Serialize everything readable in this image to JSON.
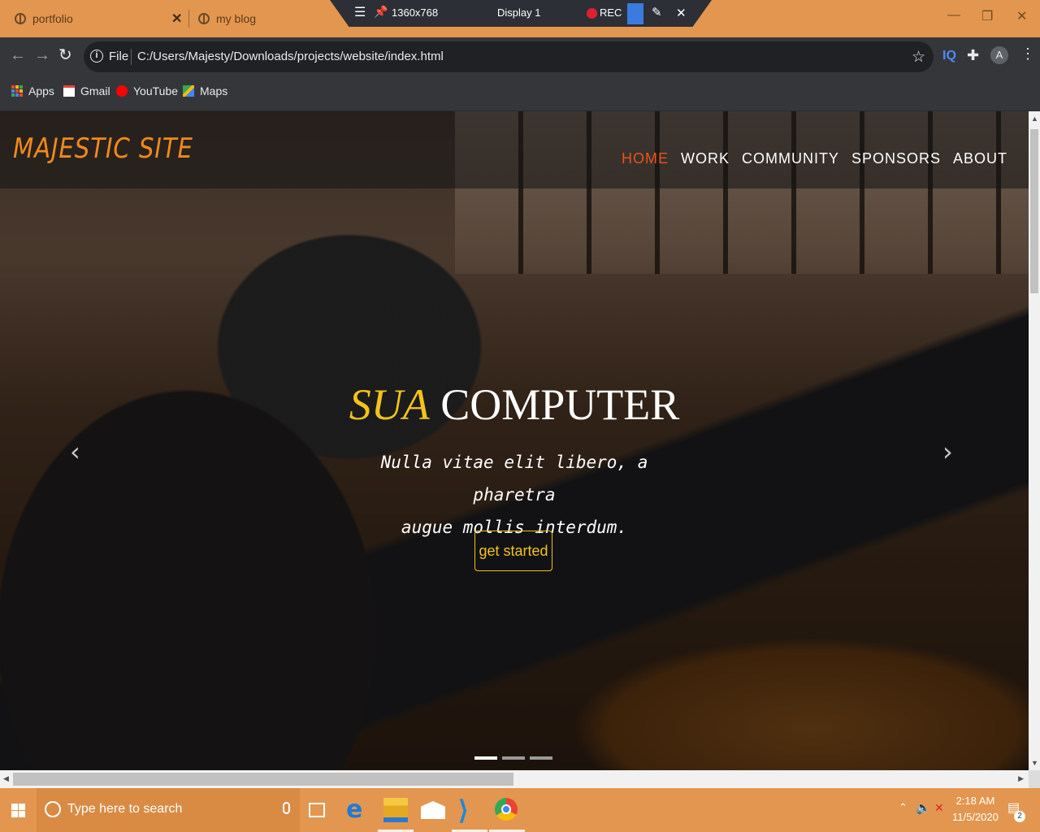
{
  "browser": {
    "tabs": [
      {
        "title": "portfolio"
      },
      {
        "title": "my blog"
      }
    ],
    "recorder": {
      "resolution": "1360x768",
      "display": "Display 1",
      "rec_label": "REC"
    },
    "address": {
      "scheme_label": "File",
      "url": "C:/Users/Majesty/Downloads/projects/website/index.html"
    },
    "profile_initial": "A",
    "ext_label": "IQ",
    "bookmarks": [
      {
        "label": "Apps"
      },
      {
        "label": "Gmail"
      },
      {
        "label": "YouTube"
      },
      {
        "label": "Maps"
      }
    ]
  },
  "site": {
    "logo": "MAJESTIC SITE",
    "nav": [
      "HOME",
      "WORK",
      "COMMUNITY",
      "SPONSORS",
      "ABOUT"
    ],
    "active_nav": "HOME",
    "hero": {
      "title_accent": "SUA",
      "title_rest": "COMPUTER",
      "subtitle_line1": "Nulla vitae elit libero, a pharetra",
      "subtitle_line2": "augue mollis interdum.",
      "cta": "get started"
    },
    "carousel": {
      "slides": 3,
      "active_slide": 1
    }
  },
  "taskbar": {
    "search_placeholder": "Type here to search",
    "apps": [
      "task-view",
      "edge",
      "file-explorer",
      "mail",
      "vscode",
      "chrome"
    ],
    "time": "2:18 AM",
    "date": "11/5/2020",
    "notifications": "2"
  },
  "colors": {
    "chrome_frame": "#e3964f",
    "logo": "#f08a1c",
    "nav_active": "#e8531c",
    "accent": "#f3c318"
  }
}
